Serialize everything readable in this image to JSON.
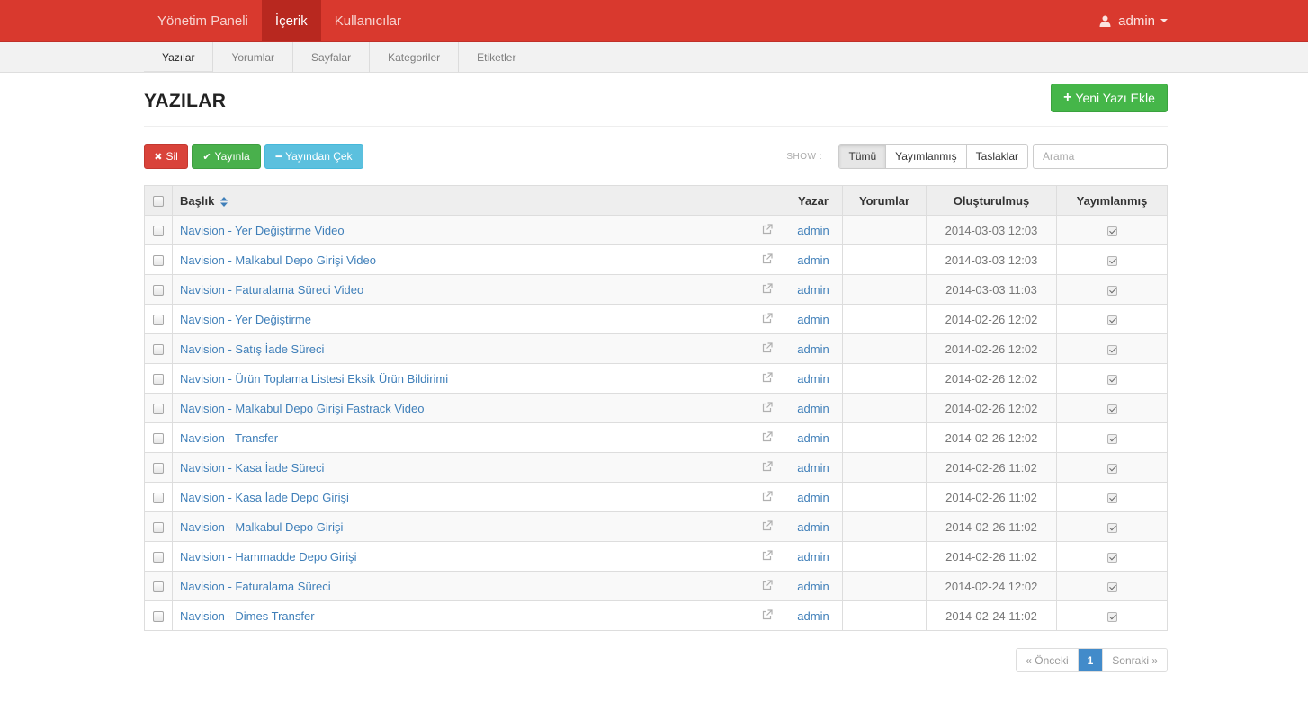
{
  "topnav": {
    "items": [
      {
        "label": "Yönetim Paneli",
        "active": false
      },
      {
        "label": "İçerik",
        "active": true
      },
      {
        "label": "Kullanıcılar",
        "active": false
      }
    ],
    "user": {
      "name": "admin",
      "icon": "user-icon"
    }
  },
  "subnav": {
    "items": [
      {
        "label": "Yazılar",
        "active": true
      },
      {
        "label": "Yorumlar",
        "active": false
      },
      {
        "label": "Sayfalar",
        "active": false
      },
      {
        "label": "Kategoriler",
        "active": false
      },
      {
        "label": "Etiketler",
        "active": false
      }
    ]
  },
  "page": {
    "title": "YAZILAR",
    "add_button": "Yeni Yazı Ekle"
  },
  "toolbar": {
    "delete_label": "Sil",
    "publish_label": "Yayınla",
    "unpublish_label": "Yayından Çek",
    "show_label": "SHOW :",
    "filters": [
      {
        "label": "Tümü",
        "active": true
      },
      {
        "label": "Yayımlanmış",
        "active": false
      },
      {
        "label": "Taslaklar",
        "active": false
      }
    ],
    "search_placeholder": "Arama"
  },
  "table": {
    "columns": {
      "title": "Başlık",
      "author": "Yazar",
      "comments": "Yorumlar",
      "created": "Oluşturulmuş",
      "published": "Yayımlanmış"
    },
    "rows": [
      {
        "title": "Navision - Yer Değiştirme Video",
        "author": "admin",
        "comments": "",
        "created": "2014-03-03 12:03",
        "published": true
      },
      {
        "title": "Navision - Malkabul Depo Girişi Video",
        "author": "admin",
        "comments": "",
        "created": "2014-03-03 12:03",
        "published": true
      },
      {
        "title": "Navision - Faturalama Süreci Video",
        "author": "admin",
        "comments": "",
        "created": "2014-03-03 11:03",
        "published": true
      },
      {
        "title": "Navision - Yer Değiştirme",
        "author": "admin",
        "comments": "",
        "created": "2014-02-26 12:02",
        "published": true
      },
      {
        "title": "Navision - Satış İade Süreci",
        "author": "admin",
        "comments": "",
        "created": "2014-02-26 12:02",
        "published": true
      },
      {
        "title": "Navision - Ürün Toplama Listesi Eksik Ürün Bildirimi",
        "author": "admin",
        "comments": "",
        "created": "2014-02-26 12:02",
        "published": true
      },
      {
        "title": "Navision - Malkabul Depo Girişi Fastrack Video",
        "author": "admin",
        "comments": "",
        "created": "2014-02-26 12:02",
        "published": true
      },
      {
        "title": "Navision - Transfer",
        "author": "admin",
        "comments": "",
        "created": "2014-02-26 12:02",
        "published": true
      },
      {
        "title": "Navision - Kasa İade Süreci",
        "author": "admin",
        "comments": "",
        "created": "2014-02-26 11:02",
        "published": true
      },
      {
        "title": "Navision - Kasa İade Depo Girişi",
        "author": "admin",
        "comments": "",
        "created": "2014-02-26 11:02",
        "published": true
      },
      {
        "title": "Navision - Malkabul Depo Girişi",
        "author": "admin",
        "comments": "",
        "created": "2014-02-26 11:02",
        "published": true
      },
      {
        "title": "Navision - Hammadde Depo Girişi",
        "author": "admin",
        "comments": "",
        "created": "2014-02-26 11:02",
        "published": true
      },
      {
        "title": "Navision - Faturalama Süreci",
        "author": "admin",
        "comments": "",
        "created": "2014-02-24 12:02",
        "published": true
      },
      {
        "title": "Navision - Dimes Transfer",
        "author": "admin",
        "comments": "",
        "created": "2014-02-24 11:02",
        "published": true
      }
    ]
  },
  "pagination": {
    "prev": "« Önceki",
    "current": "1",
    "next": "Sonraki »"
  },
  "colors": {
    "brand": "#d9392e",
    "success": "#45b649",
    "danger": "#d9433a",
    "info": "#5bc0de",
    "link": "#3f7fb9",
    "primary": "#428bca"
  }
}
